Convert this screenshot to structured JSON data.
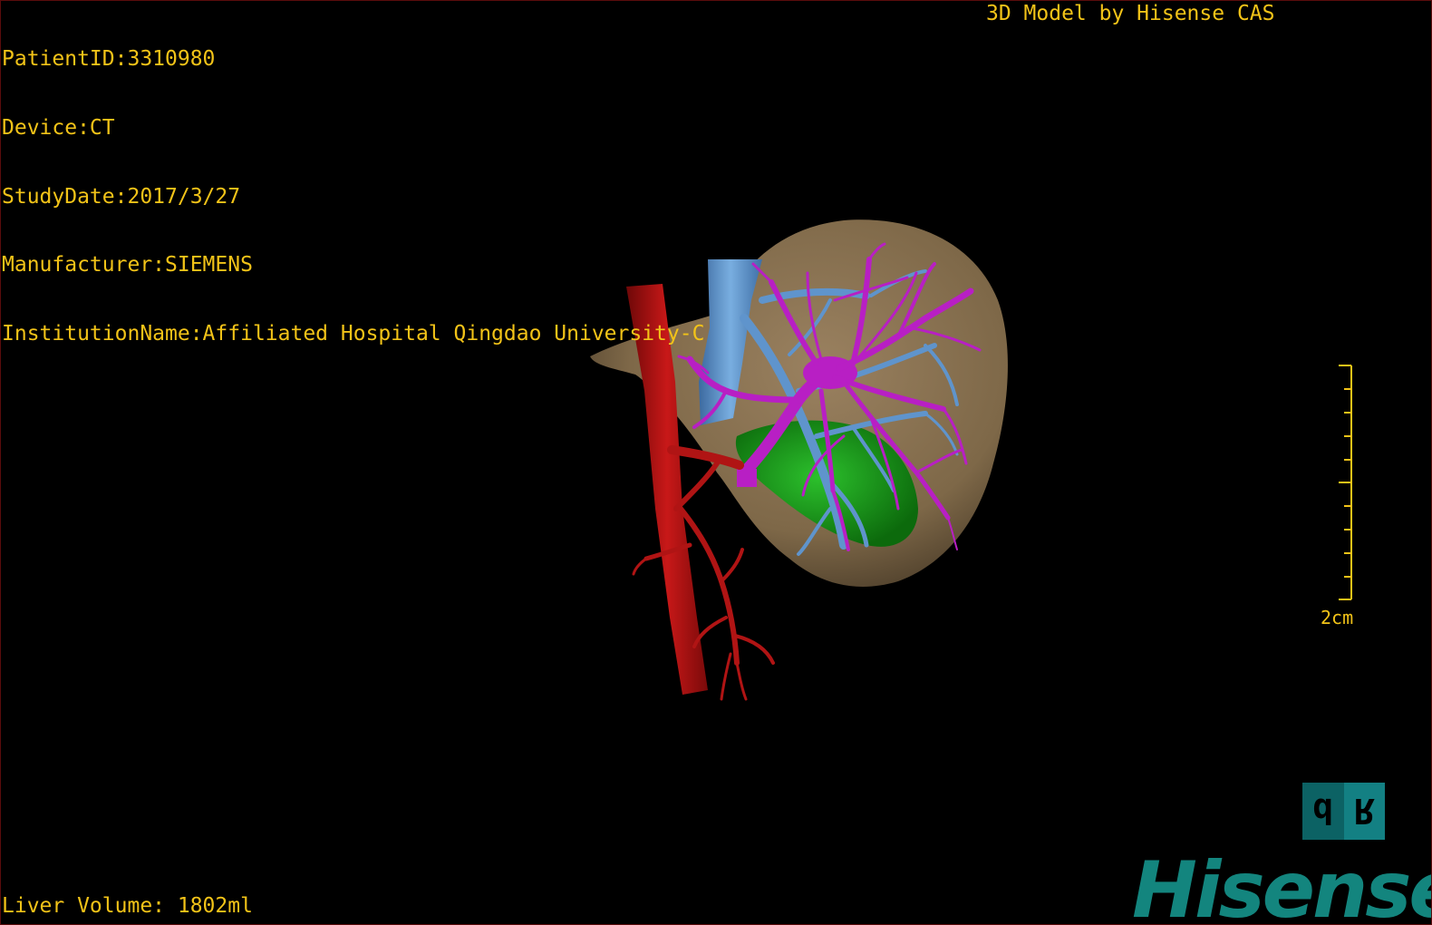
{
  "patient_info": {
    "patient_id": "PatientID:3310980",
    "device": "Device:CT",
    "study_date": "StudyDate:2017/3/27",
    "manufacturer": "Manufacturer:SIEMENS",
    "institution": "InstitutionName:Affiliated Hospital Qingdao University-C"
  },
  "model_credit": "3D Model by Hisense CAS",
  "liver_volume": "Liver Volume: 1802ml",
  "scale_bar": {
    "label": "2cm"
  },
  "orientation_cube": {
    "left_face": "d",
    "right_face": "R"
  },
  "brand": "Hisense",
  "colors": {
    "overlay_text": "#f2c318",
    "liver": "#8a7251",
    "artery": "#b01414",
    "portal_vein": "#b81fc4",
    "hepatic_vein": "#5f94cc",
    "tumor": "#1a9a1a",
    "brand": "#13857e"
  }
}
